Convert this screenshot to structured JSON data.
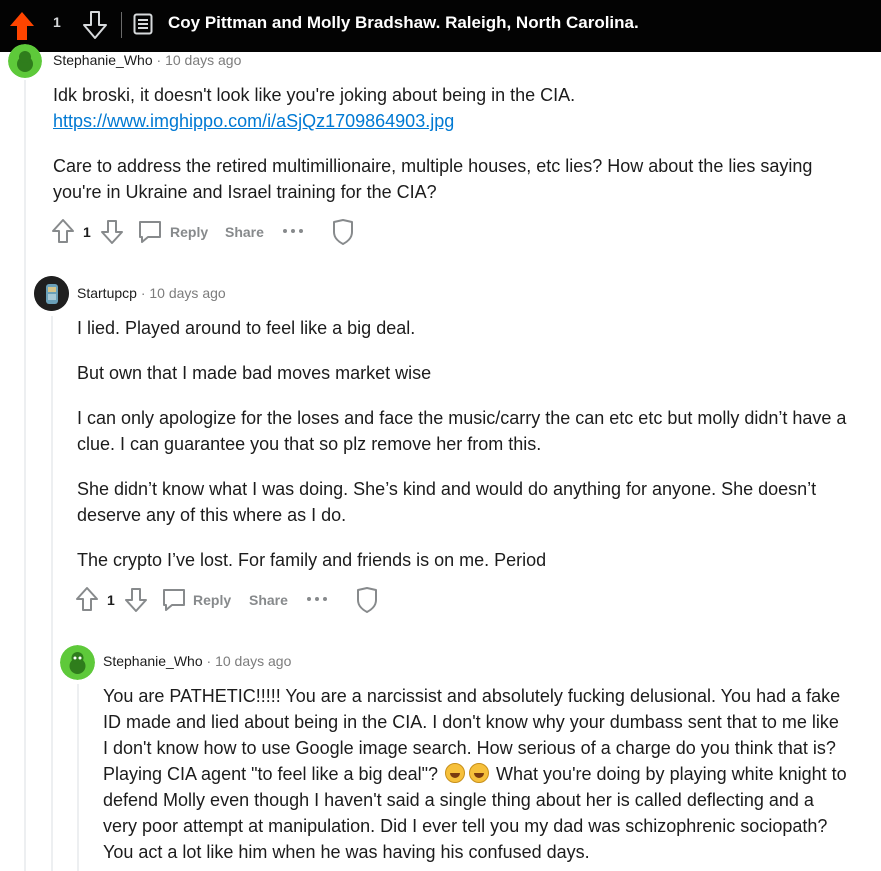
{
  "header": {
    "vote_count": "1",
    "post_title": "Coy Pittman and Molly Bradshaw. Raleigh, North Carolina."
  },
  "comments": [
    {
      "author": "Stephanie_Who",
      "separator": "·",
      "time": "10 days ago",
      "lines": [
        "Idk broski, it doesn't look like you're joking about being in the CIA."
      ],
      "link": "https://www.imghippo.com/i/aSjQz1709864903.jpg",
      "paragraph2": "Care to address the retired multimillionaire, multiple houses, etc lies? How about the lies saying you're in Ukraine and Israel training for the CIA?",
      "votes": "1",
      "reply_label": "Reply",
      "share_label": "Share"
    },
    {
      "author": "Startupcp",
      "separator": "·",
      "time": "10 days ago",
      "paragraphs": [
        "I lied. Played around to feel like a big deal.",
        "But own that I made bad moves market wise",
        "I can only apologize for the loses and face the music/carry the can etc etc but molly didn’t have a clue. I can guarantee you that so plz remove her from this.",
        "She didn’t know what I was doing. She’s kind and would do anything for anyone. She doesn’t deserve any of this where as I do.",
        "The crypto I’ve lost. For family and friends is on me. Period"
      ],
      "votes": "1",
      "reply_label": "Reply",
      "share_label": "Share"
    },
    {
      "author": "Stephanie_Who",
      "separator": "·",
      "time": "10 days ago",
      "text_before_emoji": "You are PATHETIC!!!!! You are a narcissist and absolutely fucking delusional. You had a fake ID made and lied about being in the CIA. I don't know why your dumbass sent that to me like I don't know how to use Google image search. How serious of a charge do you think that is? Playing CIA agent \"to feel like a big deal\"?",
      "text_after_emoji": "What you're doing by playing white knight to defend Molly even though I haven't said a single thing about her is called deflecting and a very poor attempt at manipulation. Did I ever tell you my dad was schizophrenic sociopath? You act a lot like him when he was having his confused days."
    }
  ],
  "colors": {
    "upvote_active": "#ff4500",
    "link": "#0079d3",
    "meta_gray": "#7c7c7c",
    "action_gray": "#878a8c",
    "avatar_green": "#5ec93a"
  }
}
